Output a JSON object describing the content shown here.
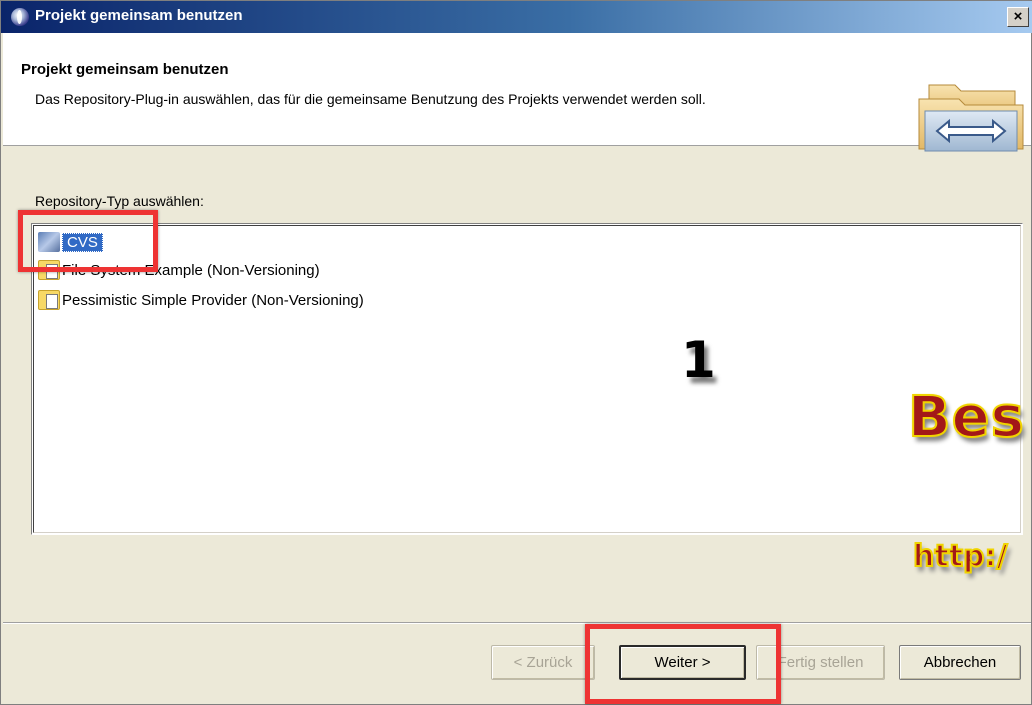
{
  "window": {
    "title": "Projekt gemeinsam benutzen",
    "close_label": "×"
  },
  "header": {
    "title": "Projekt gemeinsam benutzen",
    "description": "Das Repository-Plug-in auswählen, das für die gemeinsame Benutzung des Projekts verwendet werden soll."
  },
  "content": {
    "section_label": "Repository-Typ auswählen:",
    "repository_types": [
      {
        "label": "CVS",
        "icon": "cvs-icon",
        "selected": true
      },
      {
        "label": "File System Example (Non-Versioning)",
        "icon": "file-provider-icon",
        "selected": false
      },
      {
        "label": "Pessimistic Simple Provider (Non-Versioning)",
        "icon": "file-provider-icon",
        "selected": false
      }
    ]
  },
  "annotations": {
    "step_number": "1",
    "watermark_line1": "Bes",
    "watermark_line2": "http:/",
    "highlight_color": "#e33333"
  },
  "buttons": {
    "back": "< Zurück",
    "next": "Weiter >",
    "finish": "Fertig stellen",
    "cancel": "Abbrechen"
  },
  "colors": {
    "selection": "#316ac5",
    "watermark_fill": "#a31818",
    "watermark_outline": "#f0d400"
  }
}
